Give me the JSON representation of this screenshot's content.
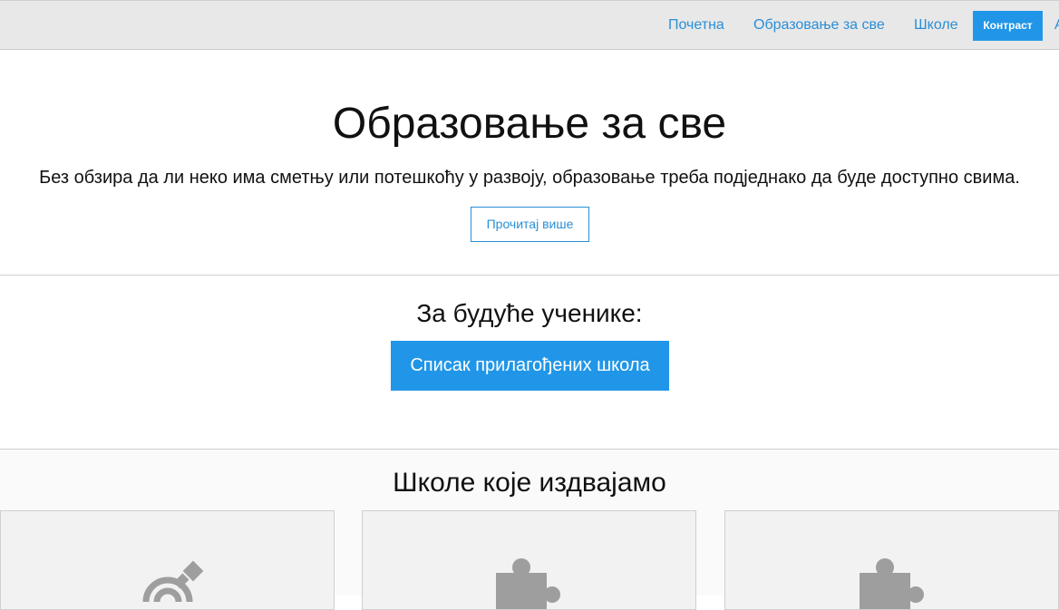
{
  "nav": {
    "items": [
      {
        "label": "Почетна"
      },
      {
        "label": "Образовање за све"
      },
      {
        "label": "Школе"
      }
    ],
    "contrast_label": "Контраст"
  },
  "hero": {
    "title": "Образовање за све",
    "subtitle": "Без обзира да ли неко има сметњу или потешкоћу у развоју, образовање треба подједнако да буде доступно свима.",
    "read_more_label": "Прочитај више"
  },
  "future_students": {
    "heading": "За будуће ученике:",
    "button_label": "Списак прилагођених школа"
  },
  "featured": {
    "heading": "Школе које издвајамо",
    "cards": [
      {
        "icon": "hearing-icon"
      },
      {
        "icon": "puzzle-icon"
      },
      {
        "icon": "puzzle-icon"
      }
    ]
  },
  "colors": {
    "accent": "#2196e8",
    "link": "#2a8fd6",
    "navbar_bg": "#e8e8e8",
    "card_bg": "#f2f2f2",
    "icon_gray": "#9e9e9e"
  }
}
